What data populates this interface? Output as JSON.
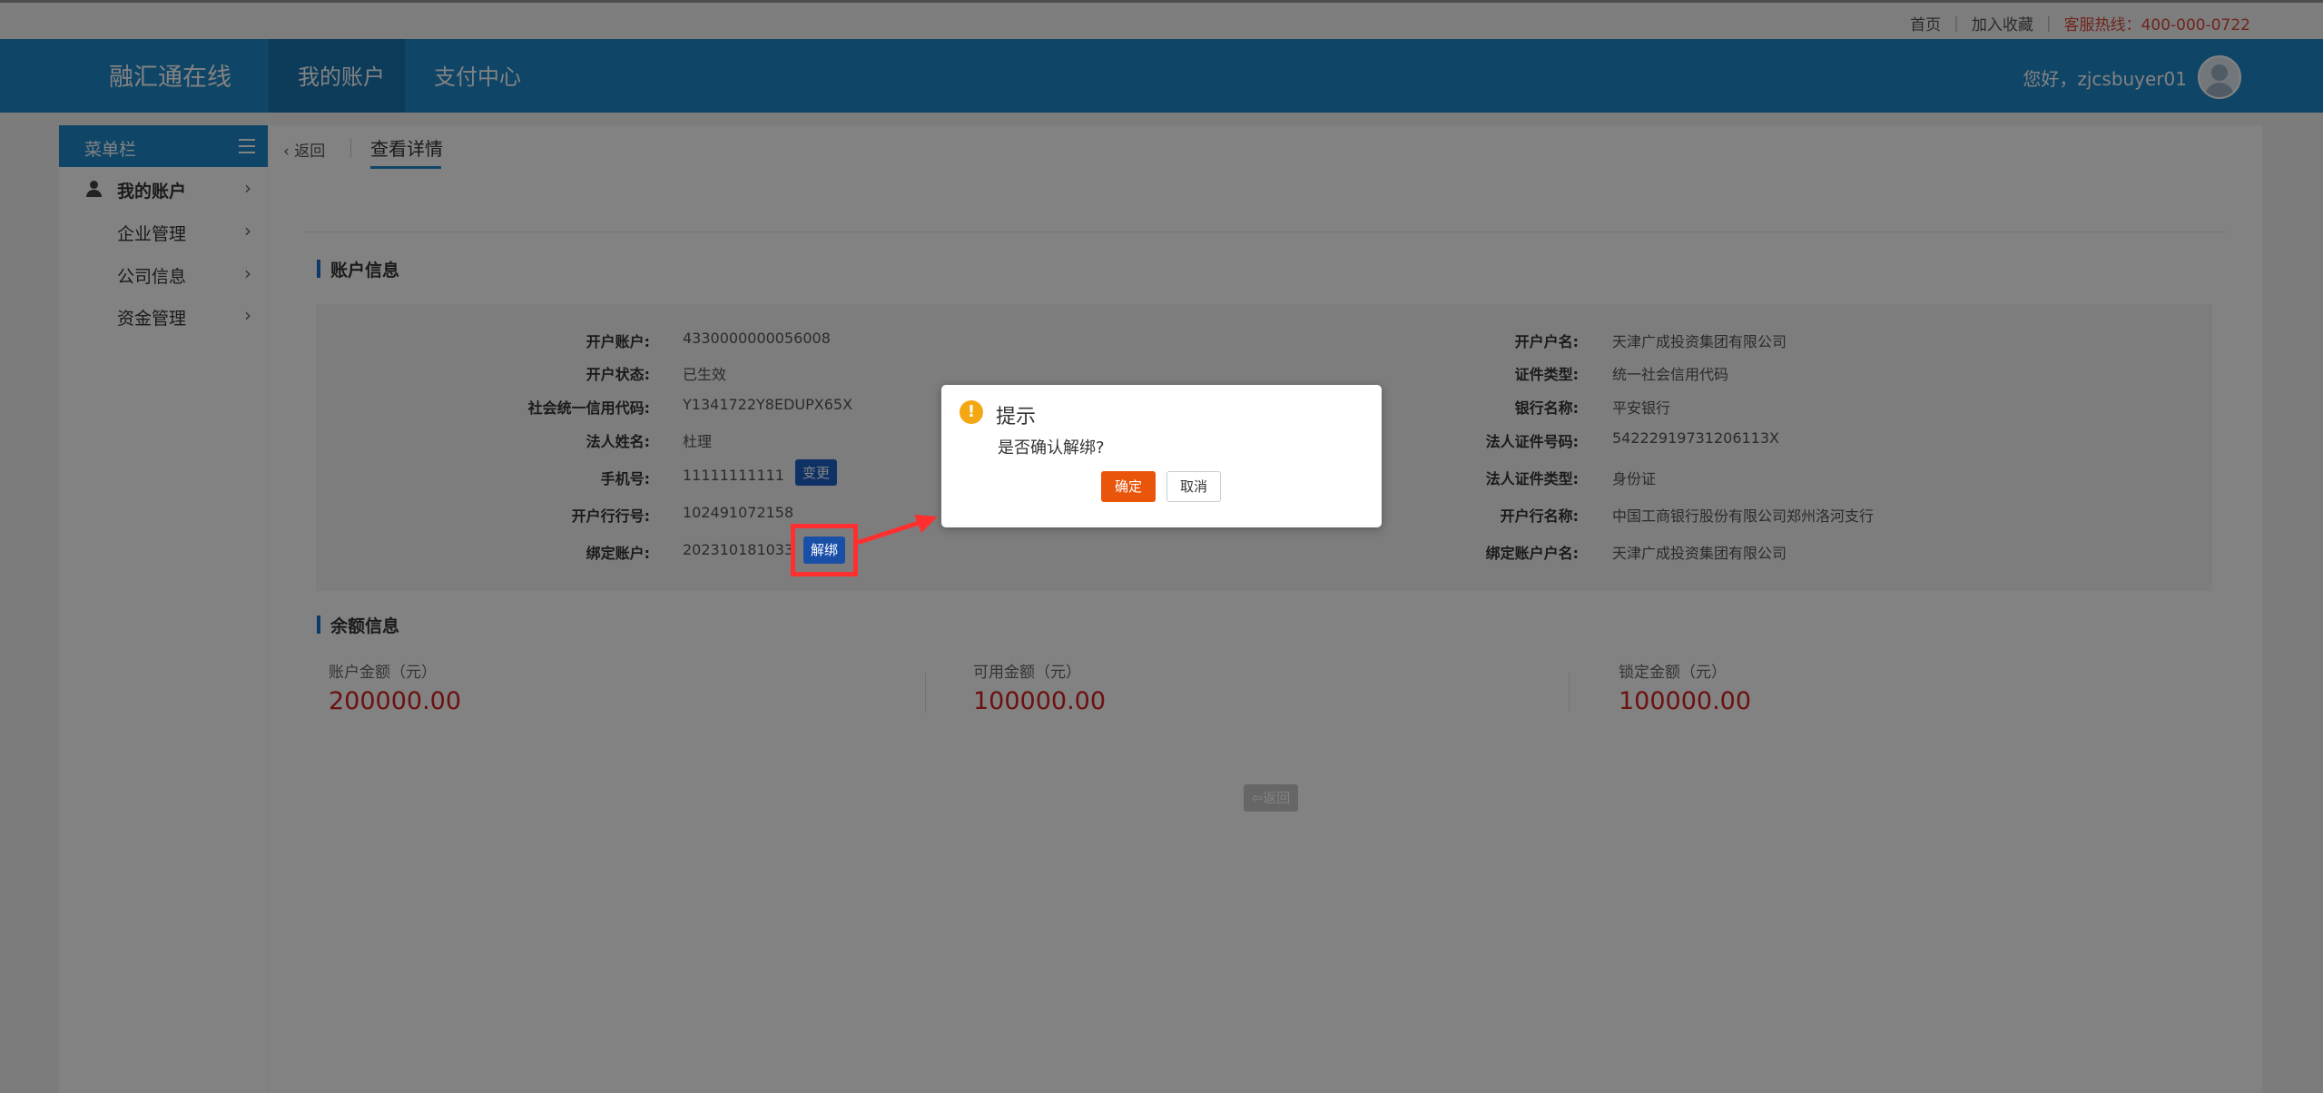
{
  "topbar": {
    "home": "首页",
    "bookmark": "加入收藏",
    "hotline": "客服热线：400-000-0722"
  },
  "header": {
    "brand": "融汇通在线",
    "nav": [
      "我的账户",
      "支付中心"
    ],
    "greeting": "您好，zjcsbuyer01"
  },
  "sidebar": {
    "title": "菜单栏",
    "items": [
      {
        "label": "我的账户"
      },
      {
        "label": "企业管理"
      },
      {
        "label": "公司信息"
      },
      {
        "label": "资金管理"
      }
    ]
  },
  "main": {
    "back": "返回",
    "tab": "查看详情",
    "account_section": "账户信息",
    "left_fields": [
      {
        "label": "开户账户:",
        "value": "4330000000056008"
      },
      {
        "label": "开户状态:",
        "value": "已生效"
      },
      {
        "label": "社会统一信用代码:",
        "value": "Y1341722Y8EDUPX65X"
      },
      {
        "label": "法人姓名:",
        "value": "杜理"
      },
      {
        "label": "手机号:",
        "value": "11111111111"
      },
      {
        "label": "开户行行号:",
        "value": "102491072158"
      },
      {
        "label": "绑定账户:",
        "value": "202310181033"
      }
    ],
    "right_fields": [
      {
        "label": "开户户名:",
        "value": "天津广成投资集团有限公司"
      },
      {
        "label": "证件类型:",
        "value": "统一社会信用代码"
      },
      {
        "label": "银行名称:",
        "value": "平安银行"
      },
      {
        "label": "法人证件号码:",
        "value": "54222919731206113X"
      },
      {
        "label": "法人证件类型:",
        "value": "身份证"
      },
      {
        "label": "开户行名称:",
        "value": "中国工商银行股份有限公司郑州洛河支行"
      },
      {
        "label": "绑定账户户名:",
        "value": "天津广成投资集团有限公司"
      }
    ],
    "change_btn": "变更",
    "unbind_btn": "解绑",
    "balance_section": "余额信息",
    "balances": [
      {
        "label": "账户金额（元）",
        "value": "200000.00"
      },
      {
        "label": "可用金额（元）",
        "value": "100000.00"
      },
      {
        "label": "锁定金额（元）",
        "value": "100000.00"
      }
    ],
    "return_btn": "返回"
  },
  "dialog": {
    "title": "提示",
    "message": "是否确认解绑?",
    "confirm": "确定",
    "cancel": "取消"
  },
  "colors": {
    "header_blue": "#1e88c8",
    "amount_red": "#d52020",
    "confirm_orange": "#e9560b",
    "highlight_red": "#ff2f2f"
  }
}
